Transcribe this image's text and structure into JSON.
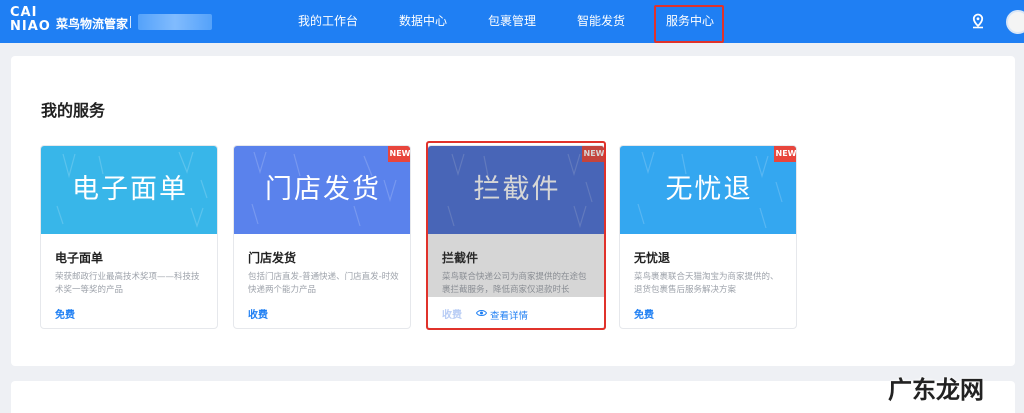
{
  "header": {
    "logo_line1": "CAI",
    "logo_line2": "NIAO",
    "brand": "菜鸟物流管家",
    "nav": [
      {
        "label": "我的工作台"
      },
      {
        "label": "数据中心"
      },
      {
        "label": "包裹管理"
      },
      {
        "label": "智能发货"
      },
      {
        "label": "服务中心"
      }
    ],
    "active_nav": "服务中心"
  },
  "section": {
    "title": "我的服务"
  },
  "cards": [
    {
      "banner_text": "电子面单",
      "title": "电子面单",
      "description": "荣获邮政行业最高技术奖项——科技技术奖一等奖的产品",
      "price": "免费",
      "is_new": false,
      "badge": "",
      "color": "#38b6e9"
    },
    {
      "banner_text": "门店发货",
      "title": "门店发货",
      "description": "包括门店直发-普通快递、门店直发-时效快递两个能力产品",
      "price": "收费",
      "is_new": true,
      "badge": "NEW",
      "color": "#5a82ec"
    },
    {
      "banner_text": "拦截件",
      "title": "拦截件",
      "description": "菜鸟联合快递公司为商家提供的在途包裹拦截服务，降低商家仅退款时长",
      "price": "收费",
      "is_new": true,
      "badge": "NEW",
      "color": "#4a6fd8",
      "hovered": true,
      "detail_label": "查看详情"
    },
    {
      "banner_text": "无忧退",
      "title": "无忧退",
      "description": "菜鸟裹裹联合天猫淘宝为商家提供的、退货包裹售后服务解决方案",
      "price": "免费",
      "is_new": true,
      "badge": "NEW",
      "color": "#34a7f0"
    }
  ],
  "watermark": "广东龙网",
  "colors": {
    "header_bg": "#1f7ff3",
    "accent": "#1f7ff3",
    "highlight": "#e0322b",
    "badge": "#e8453c"
  },
  "icons": {
    "location": "location-pin-icon",
    "eye": "eye-icon"
  }
}
